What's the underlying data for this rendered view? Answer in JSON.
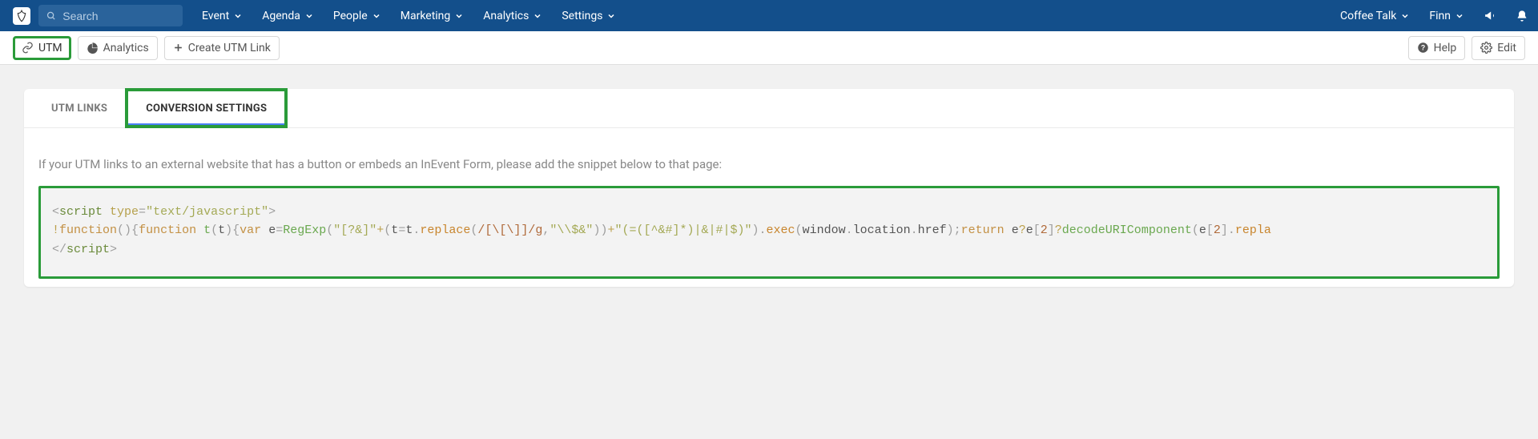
{
  "topbar": {
    "search_placeholder": "Search",
    "menu": [
      "Event",
      "Agenda",
      "People",
      "Marketing",
      "Analytics",
      "Settings"
    ],
    "event_name": "Coffee Talk",
    "user_name": "Finn"
  },
  "subbar": {
    "utm_label": "UTM",
    "analytics_label": "Analytics",
    "create_label": "Create UTM Link",
    "help_label": "Help",
    "edit_label": "Edit"
  },
  "panel": {
    "tabs": {
      "utm_links": "UTM LINKS",
      "conversion_settings": "CONVERSION SETTINGS"
    },
    "intro": "If your UTM links to an external website that has a button or embeds an InEvent Form, please add the snippet below to that page:",
    "code_tokens": {
      "script_open1": "<",
      "script_tag": "script",
      "type_attr": " type",
      "eq": "=",
      "type_val": "\"text/javascript\"",
      "gt": ">",
      "bang": "!",
      "function": "function",
      "paren": "()",
      "brace_o": "{",
      "t_name": "t",
      "t_paren": "(",
      "t_close": ")",
      "var": "var",
      "e_name": " e",
      "regexp": "RegExp",
      "re_arg1": "\"[?&]\"",
      "plus": "+",
      "t2_paren_o": "(",
      "t_assign": "t",
      "eq2": "=",
      "t_ref": "t",
      "dot": ".",
      "replace": "replace",
      "re_lit": "/[\\[\\]]/g",
      "comma": ",",
      "esc": "\"\\\\$&\"",
      "close2": "))",
      "re_tail": "\"(=([^&#]*)|&|#|$)\"",
      "close3": ")",
      "exec": "exec",
      "window": "window",
      "location": "location",
      "href": "href",
      "semicolon": ";",
      "return": "return",
      "e_ref": " e",
      "q": "?",
      "e_idx": "e",
      "bracket_o": "[",
      "two": "2",
      "bracket_c": "]",
      "decode": "decodeURIComponent",
      "repla": "repla",
      "script_close": "script"
    }
  }
}
